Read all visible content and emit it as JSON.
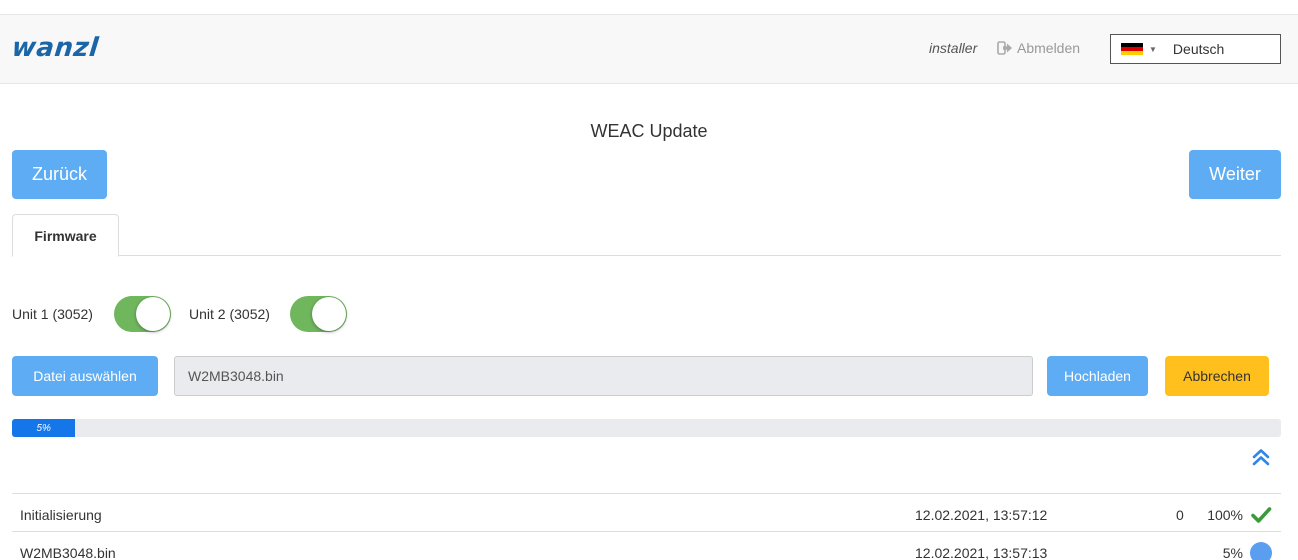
{
  "header": {
    "brand": "wanzl",
    "user": "installer",
    "logout_label": "Abmelden",
    "logout_icon": "sign-out-icon",
    "language": {
      "selected": "Deutsch",
      "flag": "de-flag-icon"
    }
  },
  "page": {
    "title": "WEAC Update"
  },
  "nav": {
    "back_label": "Zurück",
    "next_label": "Weiter"
  },
  "tabs": [
    {
      "label": "Firmware",
      "active": true
    }
  ],
  "units": [
    {
      "label": "Unit 1 (3052)",
      "enabled": true
    },
    {
      "label": "Unit 2 (3052)",
      "enabled": true
    }
  ],
  "upload": {
    "choose_label": "Datei auswählen",
    "file_name": "W2MB3048.bin",
    "upload_label": "Hochladen",
    "cancel_label": "Abbrechen"
  },
  "progress": {
    "percent": 5,
    "label": "5%"
  },
  "log": {
    "collapse_icon": "double-chevron-up-icon",
    "rows": [
      {
        "name": "Initialisierung",
        "time": "12.02.2021, 13:57:12",
        "count": "0",
        "percent": "100%",
        "status": "done",
        "status_icon": "check-icon"
      },
      {
        "name": "W2MB3048.bin",
        "time": "12.02.2021, 13:57:13",
        "count": "",
        "percent": "5%",
        "status": "in-progress",
        "status_icon": "progress-dot-icon"
      }
    ]
  },
  "colors": {
    "primary": "#5eadf4",
    "warning": "#ffc01e",
    "toggle_on": "#6fb65c",
    "progress": "#1576ea",
    "brand": "#1b66a8",
    "success": "#3c9a3c"
  }
}
